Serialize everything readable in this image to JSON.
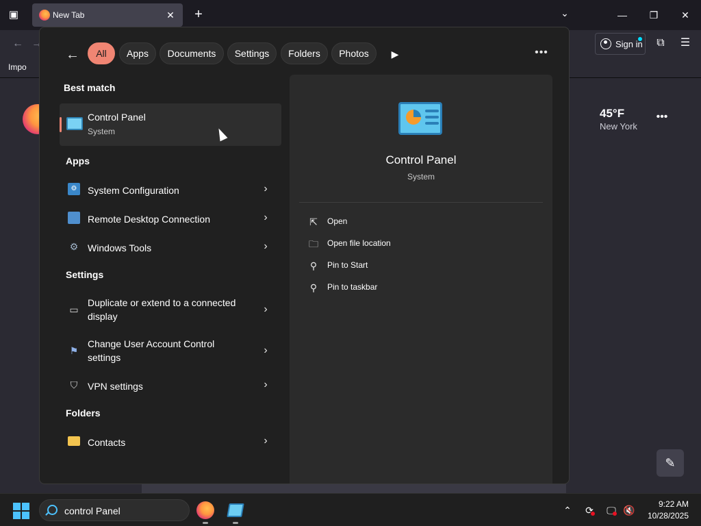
{
  "browser": {
    "tab_title": "New Tab",
    "bookmark_import": "Impo",
    "signin_label": "Sign in"
  },
  "newtab": {
    "weather_temp": "45°F",
    "weather_city": "New York"
  },
  "search": {
    "chips": [
      "All",
      "Apps",
      "Documents",
      "Settings",
      "Folders",
      "Photos"
    ],
    "best_match_heading": "Best match",
    "best_match": {
      "title": "Control Panel",
      "subtitle": "System"
    },
    "apps_heading": "Apps",
    "apps": [
      {
        "label": "System Configuration",
        "icon": "system-configuration-icon"
      },
      {
        "label": "Remote Desktop Connection",
        "icon": "remote-desktop-icon"
      },
      {
        "label": "Windows Tools",
        "icon": "windows-tools-icon"
      }
    ],
    "settings_heading": "Settings",
    "settings": [
      {
        "label": "Duplicate or extend to a connected display",
        "icon": "display-icon"
      },
      {
        "label": "Change User Account Control settings",
        "icon": "uac-flag-icon"
      },
      {
        "label": "VPN settings",
        "icon": "shield-icon"
      }
    ],
    "folders_heading": "Folders",
    "folders": [
      {
        "label": "Contacts",
        "icon": "folder-icon"
      }
    ],
    "preview": {
      "title": "Control Panel",
      "subtitle": "System",
      "actions": [
        "Open",
        "Open file location",
        "Pin to Start",
        "Pin to taskbar"
      ]
    }
  },
  "taskbar": {
    "search_text": "control Panel",
    "time": "9:22 AM",
    "date": "10/28/2025"
  },
  "colors": {
    "accent": "#f08573",
    "windows_blue": "#4cc2ff"
  }
}
